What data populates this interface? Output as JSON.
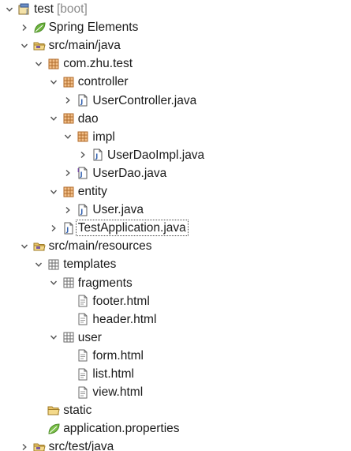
{
  "tree": {
    "rows": [
      {
        "depth": 0,
        "twisty": "open",
        "icon": "project-icon",
        "label": "test",
        "suffix": "[boot]"
      },
      {
        "depth": 1,
        "twisty": "closed",
        "icon": "spring-leaf-icon",
        "label": "Spring Elements"
      },
      {
        "depth": 1,
        "twisty": "open",
        "icon": "source-folder-icon",
        "label": "src/main/java"
      },
      {
        "depth": 2,
        "twisty": "open",
        "icon": "package-icon",
        "label": "com.zhu.test"
      },
      {
        "depth": 3,
        "twisty": "open",
        "icon": "package-icon",
        "label": "controller"
      },
      {
        "depth": 4,
        "twisty": "closed",
        "icon": "java-file-icon",
        "label": "UserController.java"
      },
      {
        "depth": 3,
        "twisty": "open",
        "icon": "package-icon",
        "label": "dao"
      },
      {
        "depth": 4,
        "twisty": "open",
        "icon": "package-icon",
        "label": "impl"
      },
      {
        "depth": 5,
        "twisty": "closed",
        "icon": "java-file-icon",
        "label": "UserDaoImpl.java"
      },
      {
        "depth": 4,
        "twisty": "closed",
        "icon": "java-interface-file-icon",
        "label": "UserDao.java"
      },
      {
        "depth": 3,
        "twisty": "open",
        "icon": "package-icon",
        "label": "entity"
      },
      {
        "depth": 4,
        "twisty": "closed",
        "icon": "java-file-icon",
        "label": "User.java"
      },
      {
        "depth": 3,
        "twisty": "closed",
        "icon": "java-file-icon",
        "label": "TestApplication.java",
        "selected": true
      },
      {
        "depth": 1,
        "twisty": "open",
        "icon": "source-folder-icon",
        "label": "src/main/resources"
      },
      {
        "depth": 2,
        "twisty": "open",
        "icon": "folder-grid-icon",
        "label": "templates"
      },
      {
        "depth": 3,
        "twisty": "open",
        "icon": "folder-grid-icon",
        "label": "fragments"
      },
      {
        "depth": 4,
        "twisty": "none",
        "icon": "html-file-icon",
        "label": "footer.html"
      },
      {
        "depth": 4,
        "twisty": "none",
        "icon": "html-file-icon",
        "label": "header.html"
      },
      {
        "depth": 3,
        "twisty": "open",
        "icon": "folder-grid-icon",
        "label": "user"
      },
      {
        "depth": 4,
        "twisty": "none",
        "icon": "html-file-icon",
        "label": "form.html"
      },
      {
        "depth": 4,
        "twisty": "none",
        "icon": "html-file-icon",
        "label": "list.html"
      },
      {
        "depth": 4,
        "twisty": "none",
        "icon": "html-file-icon",
        "label": "view.html"
      },
      {
        "depth": 2,
        "twisty": "none",
        "icon": "folder-open-icon",
        "label": "static"
      },
      {
        "depth": 2,
        "twisty": "none",
        "icon": "properties-leaf-icon",
        "label": "application.properties"
      },
      {
        "depth": 1,
        "twisty": "closed",
        "icon": "source-folder-icon",
        "label": "src/test/java"
      }
    ]
  }
}
